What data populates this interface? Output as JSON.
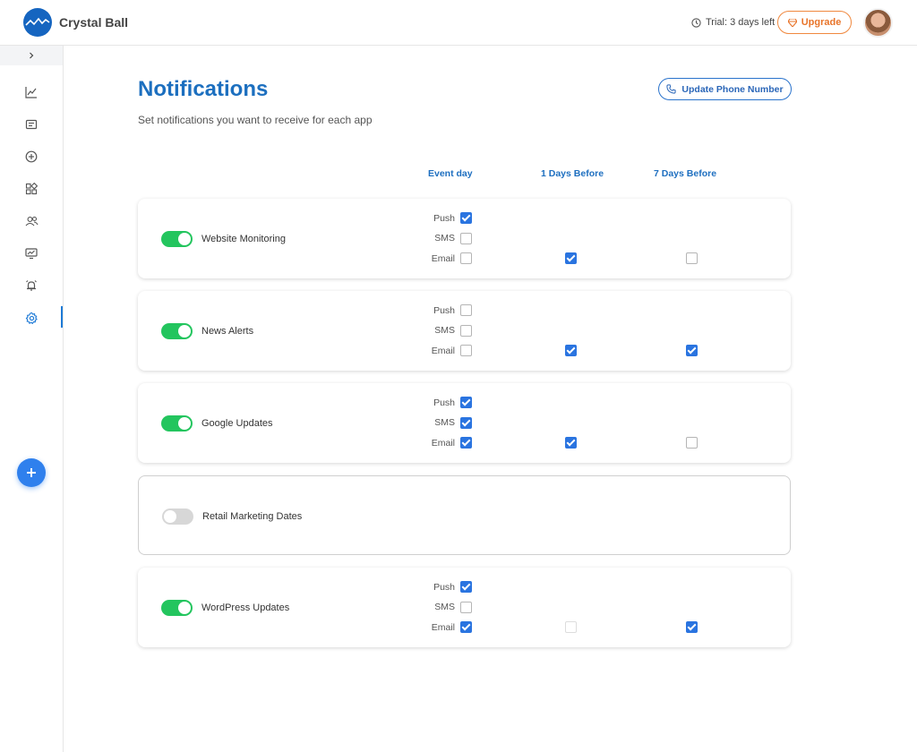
{
  "header": {
    "brand": "Crystal Ball",
    "trial_text": "Trial: 3 days left",
    "upgrade_label": "Upgrade"
  },
  "sidebar": {
    "items": [
      {
        "icon": "chart-icon",
        "active": false
      },
      {
        "icon": "newspaper-icon",
        "active": false
      },
      {
        "icon": "plus-circle-icon",
        "active": false
      },
      {
        "icon": "apps-icon",
        "active": false
      },
      {
        "icon": "users-icon",
        "active": false
      },
      {
        "icon": "monitor-icon",
        "active": false
      },
      {
        "icon": "alarm-icon",
        "active": false
      },
      {
        "icon": "gear-icon",
        "active": true
      }
    ]
  },
  "page": {
    "title": "Notifications",
    "subtitle": "Set notifications you want to receive for each app",
    "update_phone_label": "Update Phone Number"
  },
  "columns": [
    "Event day",
    "1 Days Before",
    "7 Days Before"
  ],
  "channels": [
    "Push",
    "SMS",
    "Email"
  ],
  "apps": [
    {
      "name": "Website Monitoring",
      "enabled": true,
      "push": true,
      "sms": false,
      "email": false,
      "day1": true,
      "day7": false
    },
    {
      "name": "News Alerts",
      "enabled": true,
      "push": false,
      "sms": false,
      "email": false,
      "day1": true,
      "day7": true
    },
    {
      "name": "Google Updates",
      "enabled": true,
      "push": true,
      "sms": true,
      "email": true,
      "day1": true,
      "day7": false
    },
    {
      "name": "Retail Marketing Dates",
      "enabled": false
    },
    {
      "name": "WordPress Updates",
      "enabled": true,
      "push": true,
      "sms": false,
      "email": true,
      "day1": false,
      "day7": true
    }
  ],
  "colors": {
    "accent": "#1c6fbf",
    "toggle_on": "#23c55e",
    "checkbox_on": "#2a74e0",
    "upgrade": "#f0883e"
  }
}
